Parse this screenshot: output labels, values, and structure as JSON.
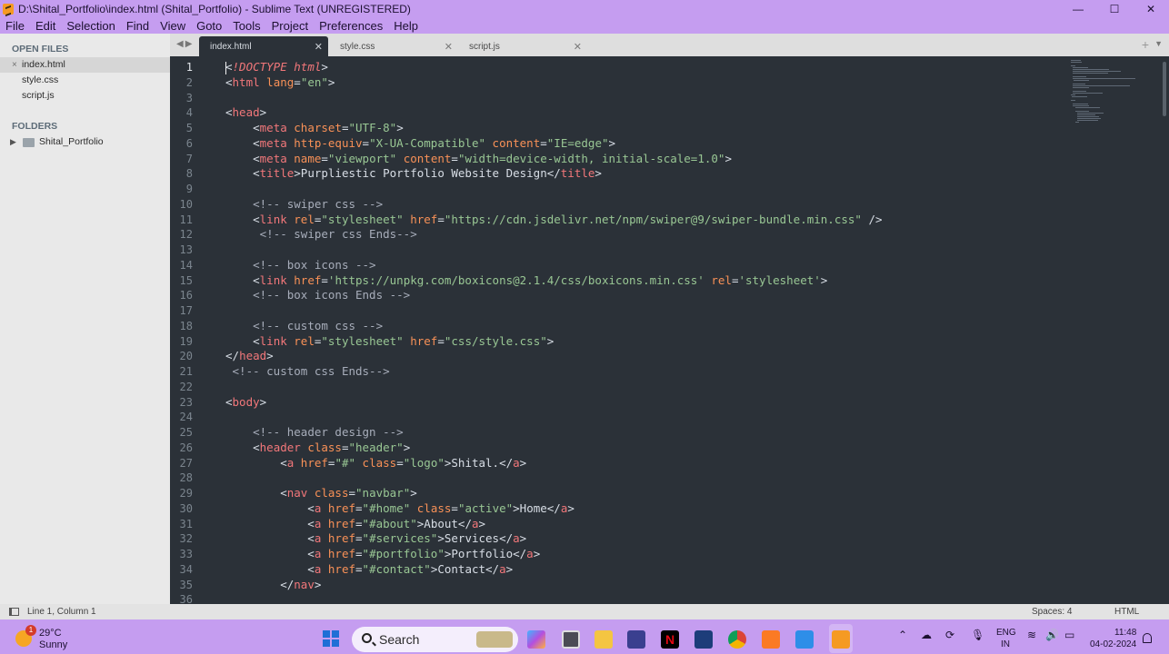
{
  "window": {
    "title": "D:\\Shital_Portfolio\\index.html (Shital_Portfolio) - Sublime Text (UNREGISTERED)",
    "minimize": "—",
    "maximize": "☐",
    "close": "✕"
  },
  "menu": [
    "File",
    "Edit",
    "Selection",
    "Find",
    "View",
    "Goto",
    "Tools",
    "Project",
    "Preferences",
    "Help"
  ],
  "sidebar": {
    "open_files_header": "OPEN FILES",
    "open_files": [
      {
        "label": "index.html",
        "active": true
      },
      {
        "label": "style.css",
        "active": false
      },
      {
        "label": "script.js",
        "active": false
      }
    ],
    "folders_header": "FOLDERS",
    "folders": [
      {
        "label": "Shital_Portfolio"
      }
    ]
  },
  "tabs": [
    {
      "label": "index.html",
      "active": true
    },
    {
      "label": "style.css",
      "active": false
    },
    {
      "label": "script.js",
      "active": false
    }
  ],
  "editor": {
    "line_numbers": [
      "1",
      "2",
      "3",
      "4",
      "5",
      "6",
      "7",
      "8",
      "9",
      "10",
      "11",
      "12",
      "13",
      "14",
      "15",
      "16",
      "17",
      "18",
      "19",
      "20",
      "21",
      "22",
      "23",
      "24",
      "25",
      "26",
      "27",
      "28",
      "29",
      "30",
      "31",
      "32",
      "33",
      "34",
      "35",
      "36"
    ],
    "current_line": 1,
    "lines": [
      "<!DOCTYPE html>",
      "<html lang=\"en\">",
      "",
      "<head>",
      "    <meta charset=\"UTF-8\">",
      "    <meta http-equiv=\"X-UA-Compatible\" content=\"IE=edge\">",
      "    <meta name=\"viewport\" content=\"width=device-width, initial-scale=1.0\">",
      "    <title>Purpliestic Portfolio Website Design</title>",
      "",
      "    <!-- swiper css -->",
      "    <link rel=\"stylesheet\" href=\"https://cdn.jsdelivr.net/npm/swiper@9/swiper-bundle.min.css\" />",
      "     <!-- swiper css Ends-->",
      "",
      "    <!-- box icons -->",
      "    <link href='https://unpkg.com/boxicons@2.1.4/css/boxicons.min.css' rel='stylesheet'>",
      "    <!-- box icons Ends -->",
      "",
      "    <!-- custom css -->",
      "    <link rel=\"stylesheet\" href=\"css/style.css\">",
      "</head>",
      " <!-- custom css Ends-->",
      "",
      "<body>",
      "",
      "    <!-- header design -->",
      "    <header class=\"header\">",
      "        <a href=\"#\" class=\"logo\">Shital.</a>",
      "",
      "        <nav class=\"navbar\">",
      "            <a href=\"#home\" class=\"active\">Home</a>",
      "            <a href=\"#about\">About</a>",
      "            <a href=\"#services\">Services</a>",
      "            <a href=\"#portfolio\">Portfolio</a>",
      "            <a href=\"#contact\">Contact</a>",
      "        </nav>",
      ""
    ]
  },
  "statusbar": {
    "position": "Line 1, Column 1",
    "spaces": "Spaces: 4",
    "syntax": "HTML"
  },
  "taskbar": {
    "weather_badge": "1",
    "temperature": "29°C",
    "condition": "Sunny",
    "search_label": "Search",
    "language_line1": "ENG",
    "language_line2": "IN",
    "time": "11:48",
    "date": "04-02-2024",
    "apps": [
      "copilot-icon",
      "task-view-icon",
      "file-explorer-icon",
      "snipping-tool-icon",
      "netflix-icon",
      "vscode-icon",
      "chrome-icon",
      "xampp-icon",
      "azure-icon",
      "sublime-text-icon"
    ]
  },
  "colors": {
    "titlebar": "#c59df0",
    "editor_bg": "#2b3138",
    "tag": "#f2777a",
    "attr": "#f99157",
    "string": "#99c794",
    "comment": "#a7adba"
  }
}
